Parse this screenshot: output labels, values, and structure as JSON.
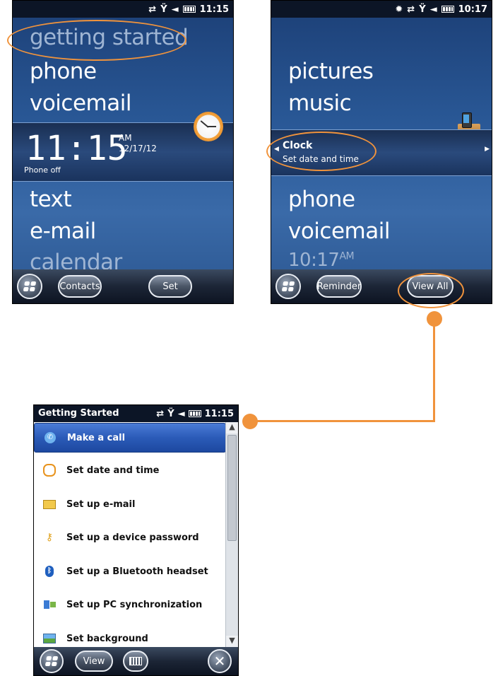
{
  "screen1": {
    "status_time": "11:15",
    "menu_top": [
      "getting started",
      "phone",
      "voicemail"
    ],
    "clock_time": "11:15",
    "clock_ampm": "AM",
    "clock_date": "12/17/12",
    "phone_status": "Phone off",
    "menu_bottom": [
      "text",
      "e-mail",
      "calendar"
    ],
    "softkey_left": "Contacts",
    "softkey_right": "Set"
  },
  "screen2": {
    "status_time": "10:17",
    "menu_top": [
      "pictures",
      "music"
    ],
    "band_title": "Clock",
    "band_subtitle": "Set date and time",
    "menu_bottom": [
      "phone",
      "voicemail"
    ],
    "time_row": "10:17",
    "time_row_ampm": "AM",
    "softkey_left": "Reminder",
    "softkey_right": "View All"
  },
  "screen3": {
    "title": "Getting Started",
    "status_time": "11:15",
    "items": [
      {
        "label": "Make a call",
        "icon": "phone-icon"
      },
      {
        "label": "Set date and time",
        "icon": "clock-icon"
      },
      {
        "label": "Set up e-mail",
        "icon": "email-icon"
      },
      {
        "label": "Set up a device password",
        "icon": "key-icon"
      },
      {
        "label": "Set up a Bluetooth headset",
        "icon": "bluetooth-icon"
      },
      {
        "label": "Set up PC synchronization",
        "icon": "sync-icon"
      },
      {
        "label": "Set background",
        "icon": "background-icon"
      }
    ],
    "softkey_left": "View"
  },
  "colors": {
    "callout": "#f0933c",
    "selection": "#2b5bb8",
    "screen_bg": "#2b5b9a"
  }
}
